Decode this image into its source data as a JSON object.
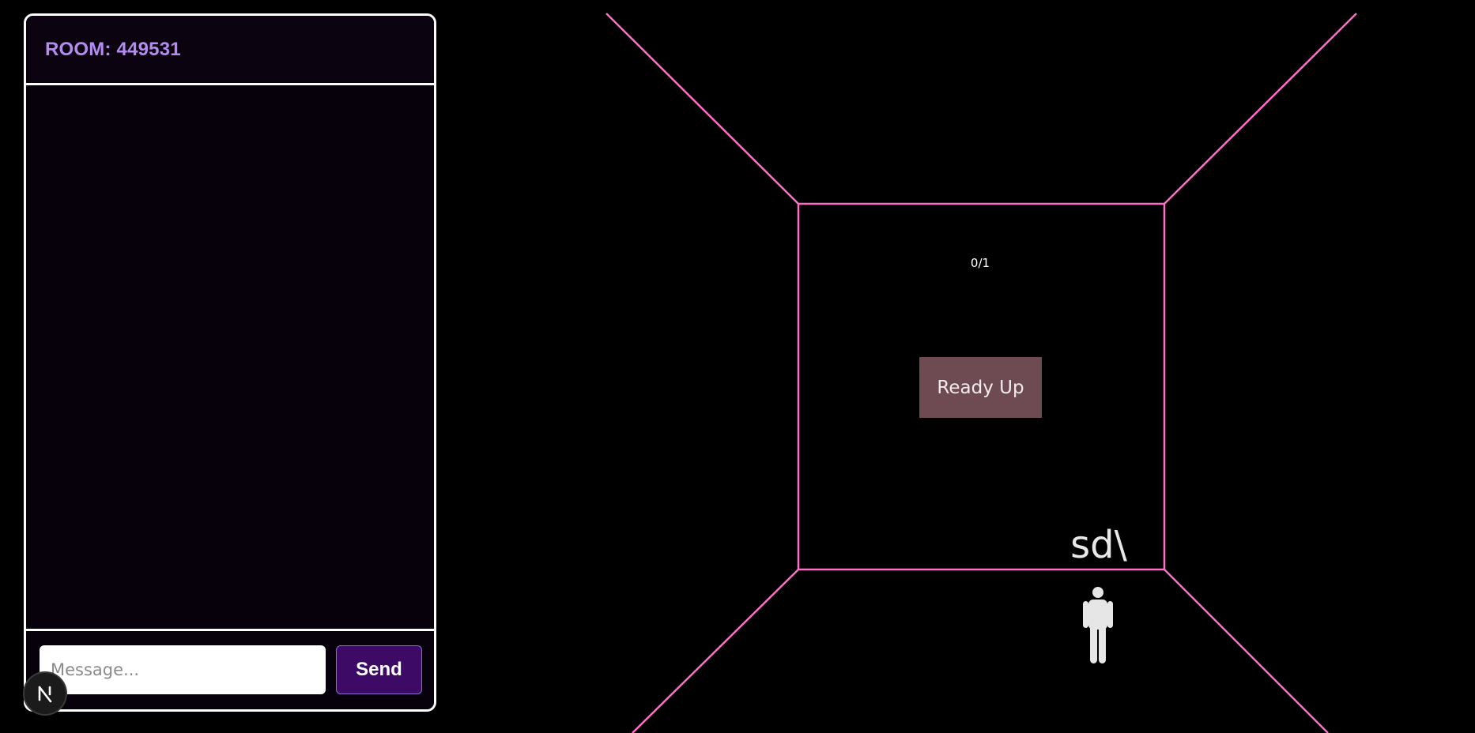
{
  "chat": {
    "room_label": "ROOM: 449531",
    "input_placeholder": "Message...",
    "input_value": "",
    "send_label": "Send"
  },
  "game": {
    "ready_count": "0/1",
    "ready_button_label": "Ready Up",
    "player_name": "sd\\",
    "player_icon": "person-icon",
    "wall_color": "#ff6ec7"
  },
  "dev_badge": {
    "icon": "nextjs-logo-icon"
  }
}
